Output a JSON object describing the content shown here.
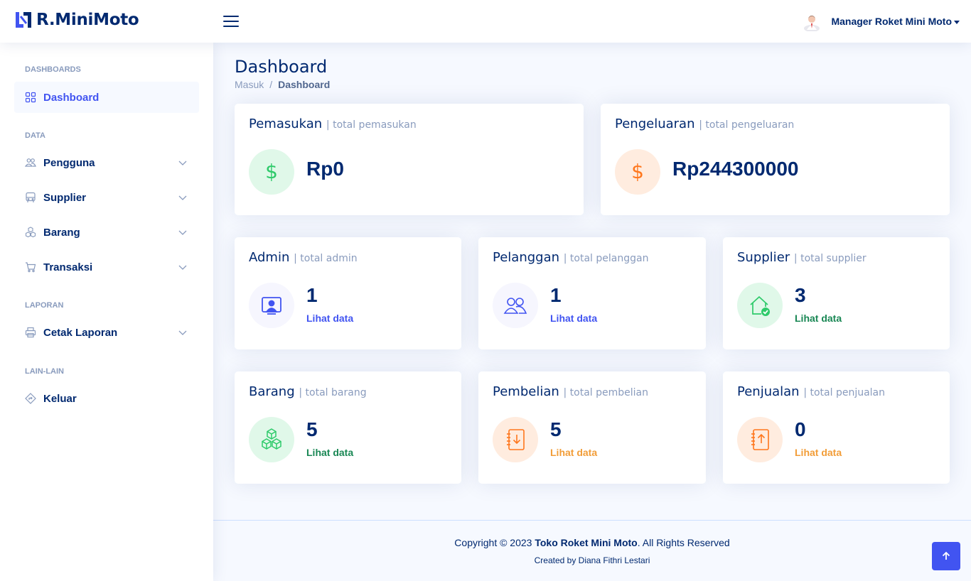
{
  "brand": {
    "name": "R.MiniMoto"
  },
  "header": {
    "profile_name": "Manager Roket Mini Moto"
  },
  "sidebar": {
    "headings": [
      "Dashboards",
      "Data",
      "Laporan",
      "Lain-lain"
    ],
    "items": [
      {
        "label": "Dashboard",
        "icon": "grid-icon",
        "active": true
      },
      {
        "label": "Pengguna",
        "icon": "people-icon"
      },
      {
        "label": "Supplier",
        "icon": "bus-icon"
      },
      {
        "label": "Barang",
        "icon": "boxes-icon"
      },
      {
        "label": "Transaksi",
        "icon": "cart-icon"
      },
      {
        "label": "Cetak Laporan",
        "icon": "printer-icon"
      },
      {
        "label": "Keluar",
        "icon": "signpost-icon"
      }
    ]
  },
  "page": {
    "title": "Dashboard",
    "breadcrumb": [
      "Masuk",
      "Dashboard"
    ]
  },
  "cards": {
    "pemasukan": {
      "title": "Pemasukan",
      "sub": "| total pemasukan",
      "value": "Rp0",
      "icon": "dollar-icon"
    },
    "pengeluaran": {
      "title": "Pengeluaran",
      "sub": "| total pengeluaran",
      "value": "Rp244300000",
      "icon": "dollar-icon"
    },
    "admin": {
      "title": "Admin",
      "sub": "| total admin",
      "value": "1",
      "link": "Lihat data",
      "icon": "person-video-icon"
    },
    "pelanggan": {
      "title": "Pelanggan",
      "sub": "| total pelanggan",
      "value": "1",
      "link": "Lihat data",
      "icon": "people-icon"
    },
    "supplier": {
      "title": "Supplier",
      "sub": "| total supplier",
      "value": "3",
      "link": "Lihat data",
      "icon": "house-check-icon"
    },
    "barang": {
      "title": "Barang",
      "sub": "| total barang",
      "value": "5",
      "link": "Lihat data",
      "icon": "boxes-icon"
    },
    "pembelian": {
      "title": "Pembelian",
      "sub": "| total pembelian",
      "value": "5",
      "link": "Lihat data",
      "icon": "journal-arrow-down-icon"
    },
    "penjualan": {
      "title": "Penjualan",
      "sub": "| total penjualan",
      "value": "0",
      "link": "Lihat data",
      "icon": "journal-arrow-up-icon"
    }
  },
  "footer": {
    "copyright_prefix": "Copyright © 2023",
    "company": "Toko Roket Mini Moto",
    "copyright_suffix": ". All Rights Reserved",
    "credits": "Created by Diana Fithri Lestari"
  },
  "colors": {
    "primary": "#4154f1",
    "navy": "#012970",
    "green": "#2eca6a",
    "orange": "#ff771d"
  }
}
